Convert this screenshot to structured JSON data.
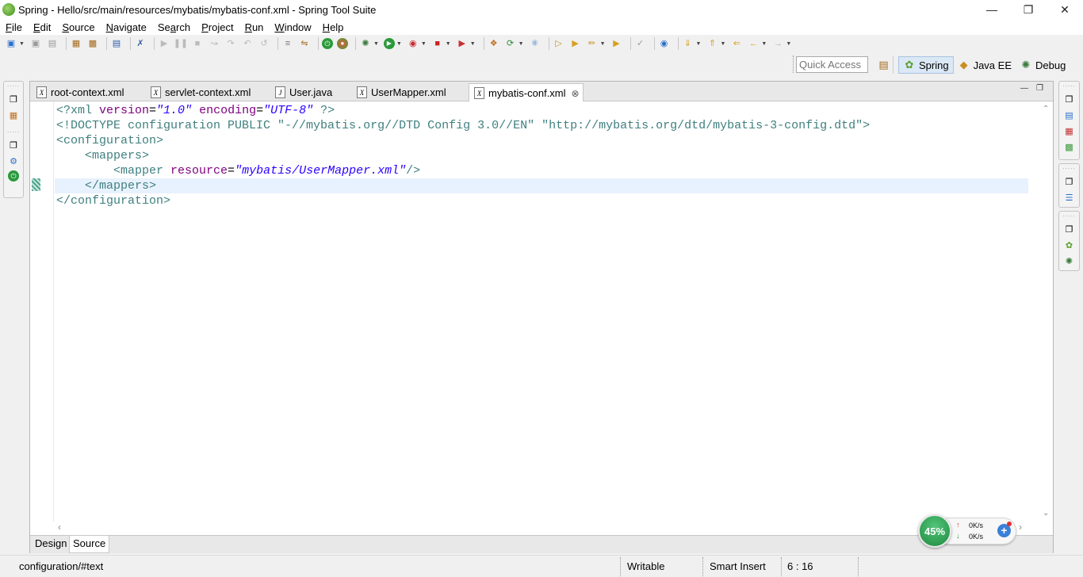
{
  "window": {
    "title": "Spring - Hello/src/main/resources/mybatis/mybatis-conf.xml - Spring Tool Suite",
    "minimize_icon": "minimize-icon",
    "maximize_icon": "restore-icon",
    "close_icon": "close-icon"
  },
  "menu": [
    {
      "label": "File",
      "mnemonic": "F",
      "rest": "ile"
    },
    {
      "label": "Edit",
      "mnemonic": "E",
      "rest": "dit"
    },
    {
      "label": "Source",
      "mnemonic": "S",
      "rest": "ource"
    },
    {
      "label": "Navigate",
      "mnemonic": "N",
      "rest": "avigate"
    },
    {
      "label": "Search",
      "mnemonic": "a",
      "prefix": "Se",
      "rest": "rch"
    },
    {
      "label": "Project",
      "mnemonic": "P",
      "rest": "roject"
    },
    {
      "label": "Run",
      "mnemonic": "R",
      "rest": "un"
    },
    {
      "label": "Window",
      "mnemonic": "W",
      "rest": "indow"
    },
    {
      "label": "Help",
      "mnemonic": "H",
      "rest": "elp"
    }
  ],
  "quick_access": {
    "placeholder": "Quick Access"
  },
  "perspectives": [
    {
      "label": "Spring",
      "icon": "spring-leaf-icon",
      "active": true
    },
    {
      "label": "Java EE",
      "icon": "java-ee-icon",
      "active": false
    },
    {
      "label": "Debug",
      "icon": "debug-bug-icon",
      "active": false
    }
  ],
  "tabs": [
    {
      "label": "root-context.xml",
      "icon": "xml-file-icon"
    },
    {
      "label": "servlet-context.xml",
      "icon": "xml-file-icon"
    },
    {
      "label": "User.java",
      "icon": "java-file-icon"
    },
    {
      "label": "UserMapper.xml",
      "icon": "xml-file-icon"
    },
    {
      "label": "mybatis-conf.xml",
      "icon": "xml-file-icon",
      "active": true
    }
  ],
  "code": {
    "line1": {
      "open": "<?xml ",
      "attr1": "version",
      "eq1": "=",
      "val1": "\"1.0\"",
      "attr2": " encoding",
      "eq2": "=",
      "val2": "\"UTF-8\"",
      "close": " ?>"
    },
    "line2": "<!DOCTYPE configuration PUBLIC \"-//mybatis.org//DTD Config 3.0//EN\" \"http://mybatis.org/dtd/mybatis-3-config.dtd\">",
    "line3": "<configuration>",
    "line4": "    <mappers>",
    "line5": {
      "open": "        <mapper ",
      "attr": "resource",
      "eq": "=",
      "val": "\"mybatis/UserMapper.xml\"",
      "close": "/>"
    },
    "line6": "    </mappers>",
    "line7": "</configuration>"
  },
  "bottom_tabs": [
    {
      "label": "Design"
    },
    {
      "label": "Source",
      "active": true
    }
  ],
  "status": {
    "path": "configuration/#text",
    "writable": "Writable",
    "insert_mode": "Smart Insert",
    "cursor": "6 : 16"
  },
  "net_widget": {
    "percent": "45%",
    "up": "0K/s",
    "down": "0K/s"
  },
  "colors": {
    "tag": "#3f7f7f",
    "attr": "#7f007f",
    "value": "#2a00ff",
    "current_line": "#e8f2fe",
    "perspective_active": "#dbe8f5"
  }
}
